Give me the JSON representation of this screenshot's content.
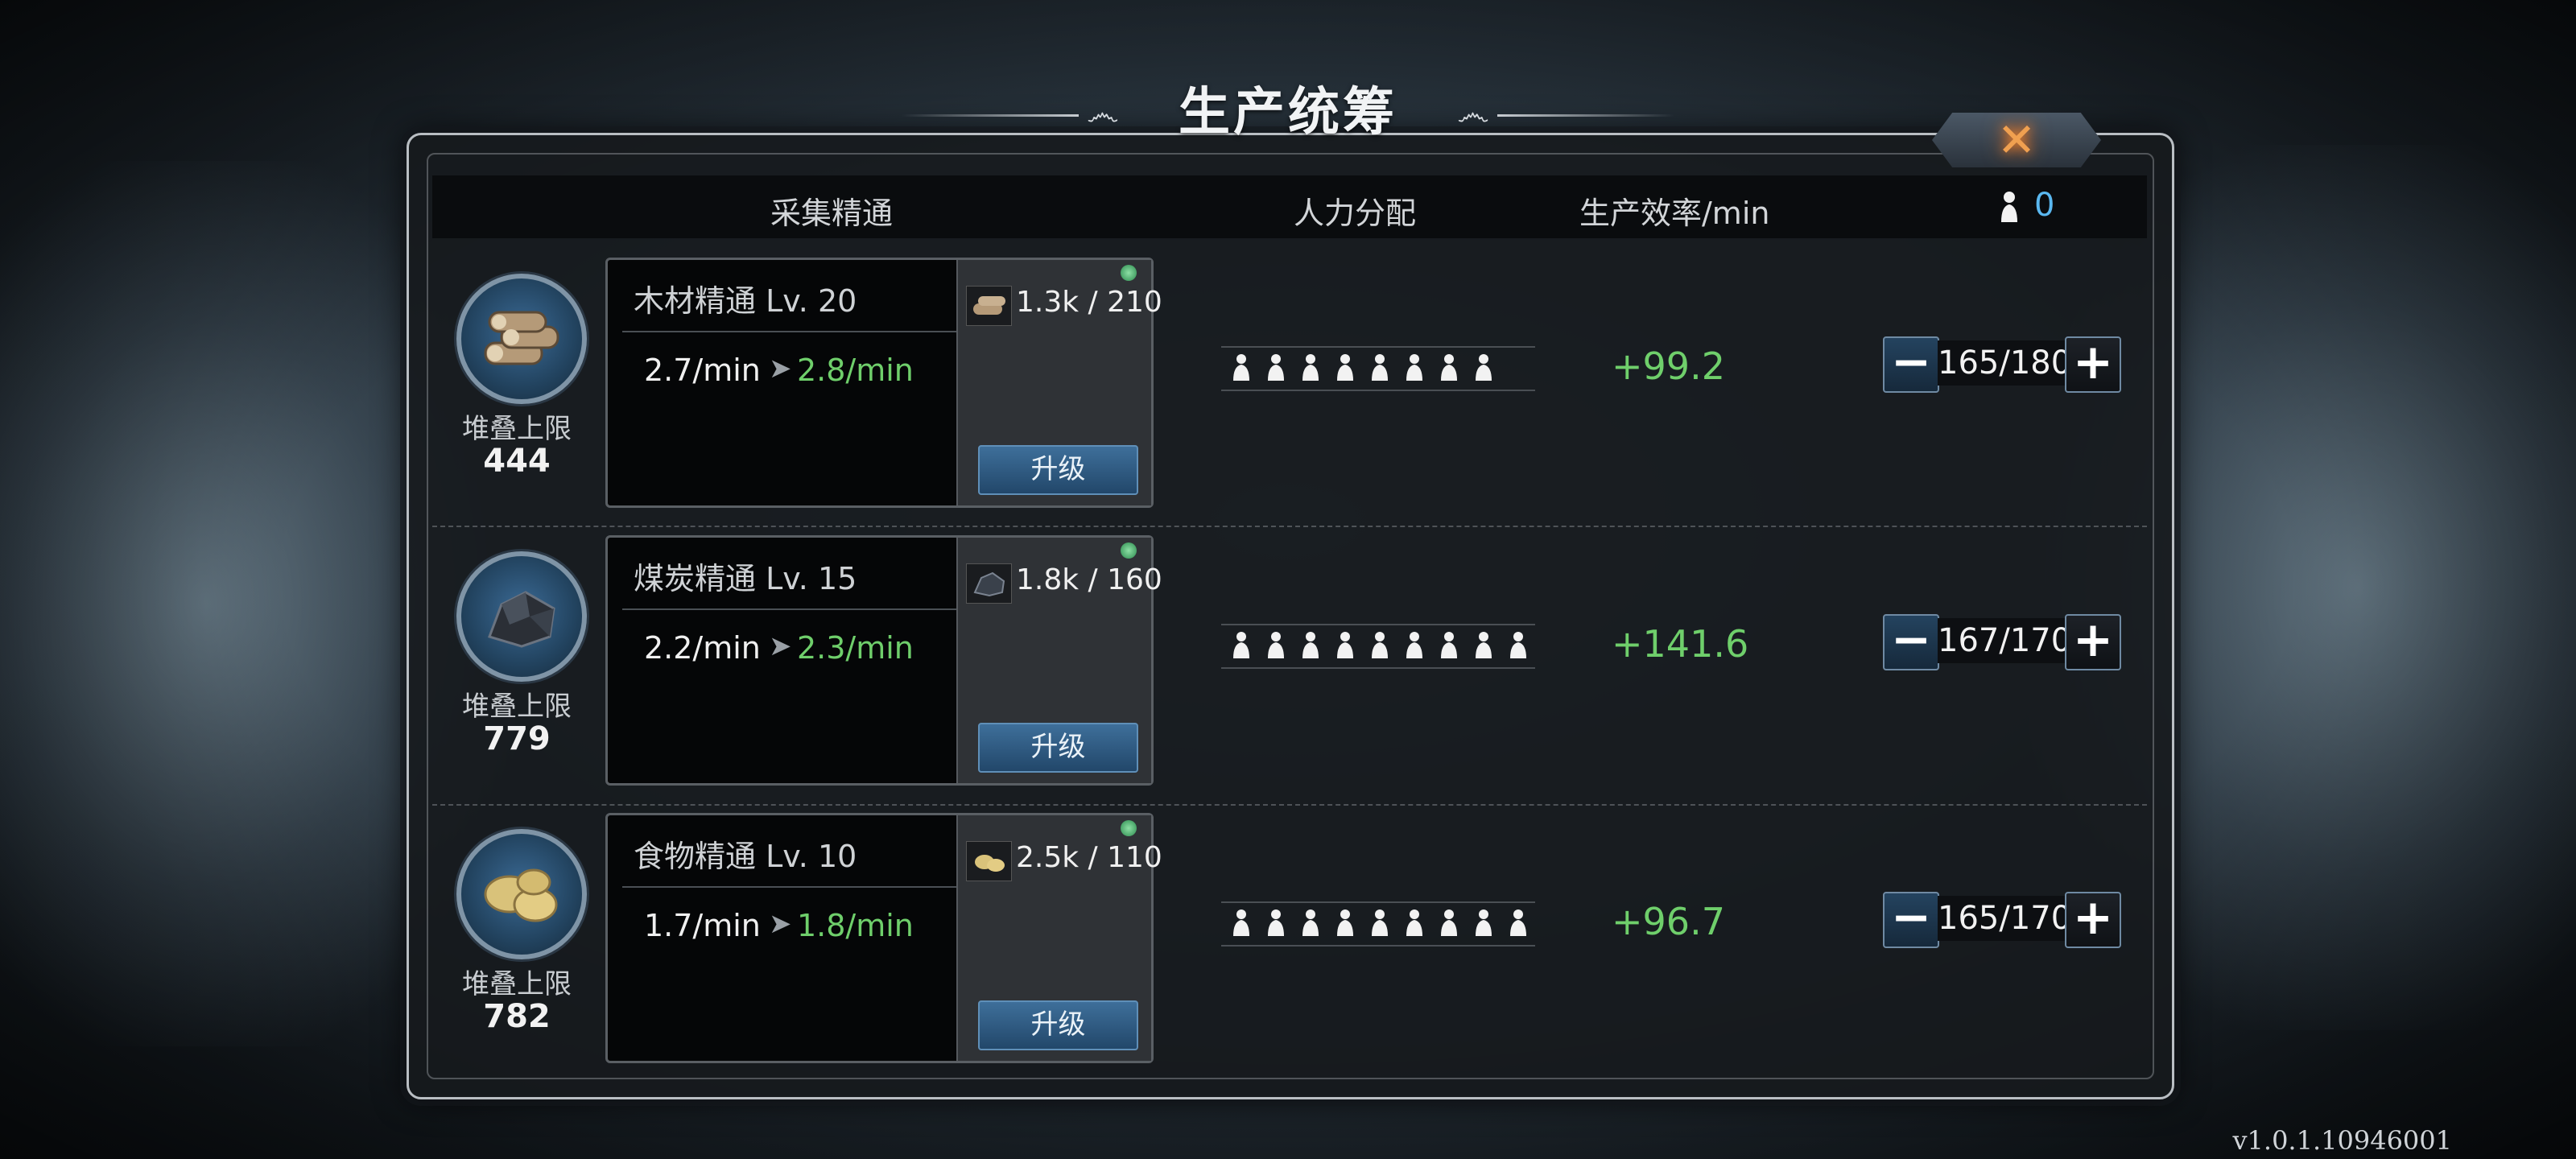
{
  "window": {
    "title": "生产统筹"
  },
  "header": {
    "gather_mastery": "采集精通",
    "manpower": "人力分配",
    "efficiency": "生产效率/min",
    "idle_workers": "0"
  },
  "rows": [
    {
      "resource_icon": "wood-logs-icon",
      "stack_label": "堆叠上限",
      "stack_value": "444",
      "title": "木材精通 Lv. 20",
      "rate_now": "2.7/min",
      "rate_next": "2.8/min",
      "item_icon": "wood-logs-icon",
      "item_count": "1.3k / 210",
      "upgrade_label": "升级",
      "workers_assigned": 8,
      "efficiency": "+99.2",
      "stepper_value": "165/180"
    },
    {
      "resource_icon": "coal-ore-icon",
      "stack_label": "堆叠上限",
      "stack_value": "779",
      "title": "煤炭精通 Lv. 15",
      "rate_now": "2.2/min",
      "rate_next": "2.3/min",
      "item_icon": "coal-ore-icon",
      "item_count": "1.8k / 160",
      "upgrade_label": "升级",
      "workers_assigned": 9,
      "efficiency": "+141.6",
      "stepper_value": "167/170"
    },
    {
      "resource_icon": "potato-food-icon",
      "stack_label": "堆叠上限",
      "stack_value": "782",
      "title": "食物精通 Lv. 10",
      "rate_now": "1.7/min",
      "rate_next": "1.8/min",
      "item_icon": "potato-food-icon",
      "item_count": "2.5k / 110",
      "upgrade_label": "升级",
      "workers_assigned": 9,
      "efficiency": "+96.7",
      "stepper_value": "165/170"
    }
  ],
  "version": "v1.0.1.10946001",
  "colors": {
    "positive": "#6fcf6b",
    "worker_count": "#5ab8f0",
    "close_glow": "#ff8a2a"
  }
}
